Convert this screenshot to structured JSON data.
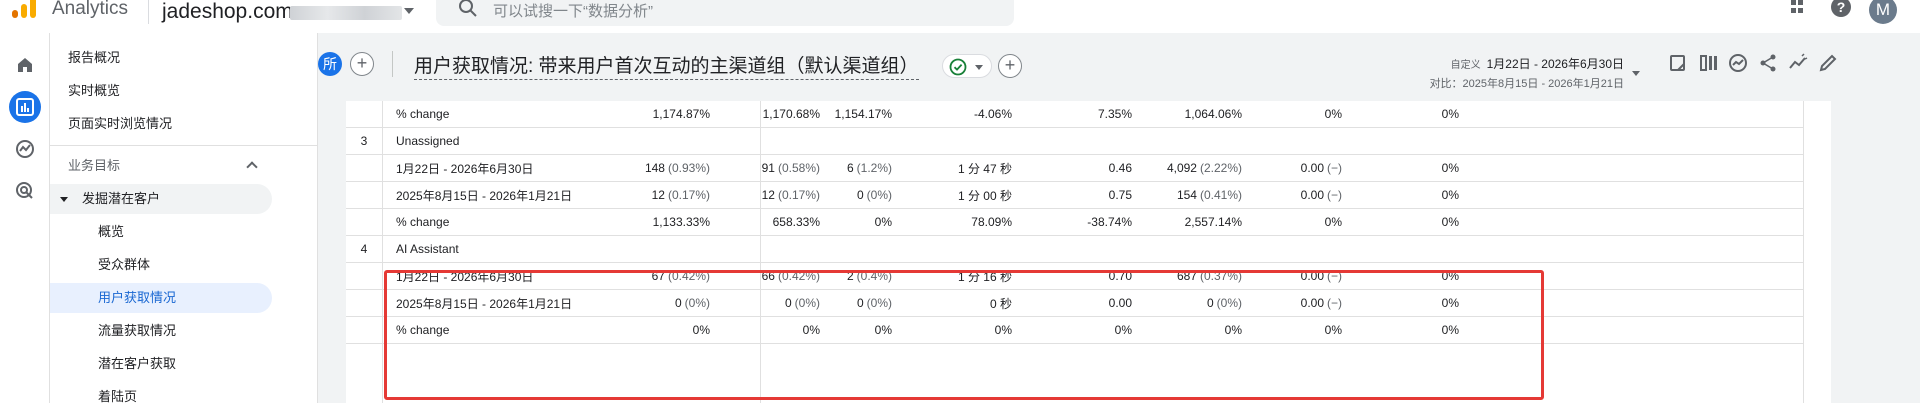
{
  "topbar": {
    "app_name": "Analytics",
    "account": "jadeshop.com",
    "search_placeholder": "可以试搜一下“数据分析”",
    "avatar_letter": "M"
  },
  "nav": {
    "items": [
      {
        "label": "报告概况"
      },
      {
        "label": "实时概览"
      },
      {
        "label": "页面实时浏览情况"
      }
    ],
    "group_title": "业务目标",
    "group_item": "发掘潜在客户",
    "sub_items": [
      {
        "label": "概览"
      },
      {
        "label": "受众群体"
      },
      {
        "label": "用户获取情况"
      },
      {
        "label": "流量获取情况"
      },
      {
        "label": "潜在客户获取"
      },
      {
        "label": "着陆页"
      }
    ]
  },
  "report": {
    "all_chip": "所",
    "title": "用户获取情况: 带来用户首次互动的主渠道组（默认渠道组）",
    "date_label": "自定义",
    "date_range": "1月22日 - 2026年6月30日",
    "compare_range": "对比：2025年8月15日 - 2026年1月21日"
  },
  "table": {
    "rows": [
      {
        "type": "metric",
        "label": "% change",
        "cells": [
          [
            "1,174.87%",
            ""
          ],
          [
            "1,170.68%",
            ""
          ],
          [
            "1,154.17%",
            ""
          ],
          [
            "-4.06%",
            ""
          ],
          [
            "7.35%",
            ""
          ],
          [
            "1,064.06%",
            ""
          ],
          [
            "0%",
            ""
          ],
          [
            "0%",
            ""
          ]
        ]
      },
      {
        "type": "group",
        "index": "3",
        "label": "Unassigned"
      },
      {
        "type": "metric",
        "label": "1月22日 - 2026年6月30日",
        "cells": [
          [
            "148",
            "(0.93%)"
          ],
          [
            "91",
            "(0.58%)"
          ],
          [
            "6",
            "(1.2%)"
          ],
          [
            "1 分 47 秒",
            ""
          ],
          [
            "0.46",
            ""
          ],
          [
            "4,092",
            "(2.22%)"
          ],
          [
            "0.00",
            "(−)"
          ],
          [
            "0%",
            ""
          ]
        ]
      },
      {
        "type": "metric",
        "label": "2025年8月15日 - 2026年1月21日",
        "cells": [
          [
            "12",
            "(0.17%)"
          ],
          [
            "12",
            "(0.17%)"
          ],
          [
            "0",
            "(0%)"
          ],
          [
            "1 分 00 秒",
            ""
          ],
          [
            "0.75",
            ""
          ],
          [
            "154",
            "(0.41%)"
          ],
          [
            "0.00",
            "(−)"
          ],
          [
            "0%",
            ""
          ]
        ]
      },
      {
        "type": "metric",
        "label": "% change",
        "cells": [
          [
            "1,133.33%",
            ""
          ],
          [
            "658.33%",
            ""
          ],
          [
            "0%",
            ""
          ],
          [
            "78.09%",
            ""
          ],
          [
            "-38.74%",
            ""
          ],
          [
            "2,557.14%",
            ""
          ],
          [
            "0%",
            ""
          ],
          [
            "0%",
            ""
          ]
        ]
      },
      {
        "type": "group",
        "index": "4",
        "label": "AI Assistant"
      },
      {
        "type": "metric",
        "label": "1月22日 - 2026年6月30日",
        "cells": [
          [
            "67",
            "(0.42%)"
          ],
          [
            "66",
            "(0.42%)"
          ],
          [
            "2",
            "(0.4%)"
          ],
          [
            "1 分 16 秒",
            ""
          ],
          [
            "0.70",
            ""
          ],
          [
            "687",
            "(0.37%)"
          ],
          [
            "0.00",
            "(−)"
          ],
          [
            "0%",
            ""
          ]
        ]
      },
      {
        "type": "metric",
        "label": "2025年8月15日 - 2026年1月21日",
        "cells": [
          [
            "0",
            "(0%)"
          ],
          [
            "0",
            "(0%)"
          ],
          [
            "0",
            "(0%)"
          ],
          [
            "0 秒",
            ""
          ],
          [
            "0.00",
            ""
          ],
          [
            "0",
            "(0%)"
          ],
          [
            "0.00",
            "(−)"
          ],
          [
            "0%",
            ""
          ]
        ]
      },
      {
        "type": "metric",
        "label": "% change",
        "cells": [
          [
            "0%",
            ""
          ],
          [
            "0%",
            ""
          ],
          [
            "0%",
            ""
          ],
          [
            "0%",
            ""
          ],
          [
            "0%",
            ""
          ],
          [
            "0%",
            ""
          ],
          [
            "0%",
            ""
          ],
          [
            "0%",
            ""
          ]
        ]
      }
    ]
  },
  "colors": {
    "accent": "#1a73e8",
    "highlight": "#e53935",
    "brand_orange": "#f9ab00",
    "check_green": "#188038"
  }
}
